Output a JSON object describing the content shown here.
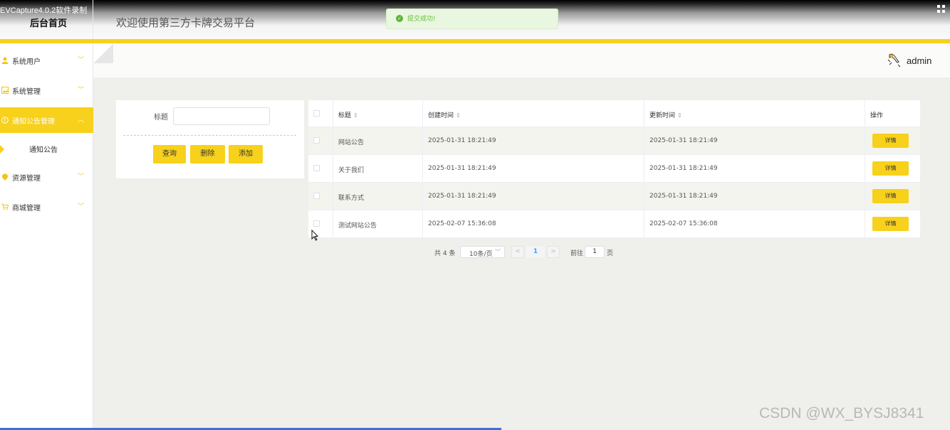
{
  "recorder": {
    "title": "EVCapture4.0.2软件录制"
  },
  "header": {
    "brand": "后台首页",
    "welcome": "欢迎使用第三方卡牌交易平台",
    "toast": "提交成功!",
    "user": "admin"
  },
  "colors": {
    "accent": "#f7d11b",
    "success": "#67c23a",
    "link": "#409eff"
  },
  "sidebar": {
    "items": [
      {
        "label": "系统用户",
        "icon": "user-icon"
      },
      {
        "label": "系统管理",
        "icon": "image-icon"
      },
      {
        "label": "通知公告管理",
        "icon": "info-icon",
        "active": true
      },
      {
        "label": "资源管理",
        "icon": "pin-icon"
      },
      {
        "label": "商城管理",
        "icon": "cart-icon"
      }
    ],
    "sub_item": "通知公告"
  },
  "search": {
    "title_label": "标题",
    "title_value": "",
    "query_label": "查询",
    "delete_label": "删除",
    "add_label": "添加"
  },
  "table": {
    "columns": [
      "标题",
      "创建时间",
      "更新时间",
      "操作"
    ],
    "rows": [
      {
        "title": "网站公告",
        "created": "2025-01-31 18:21:49",
        "updated": "2025-01-31 18:21:49",
        "action": "详情"
      },
      {
        "title": "关于我们",
        "created": "2025-01-31 18:21:49",
        "updated": "2025-01-31 18:21:49",
        "action": "详情"
      },
      {
        "title": "联系方式",
        "created": "2025-01-31 18:21:49",
        "updated": "2025-01-31 18:21:49",
        "action": "详情"
      },
      {
        "title": "测试网站公告",
        "created": "2025-02-07 15:36:08",
        "updated": "2025-02-07 15:36:08",
        "action": "详情"
      }
    ]
  },
  "pagination": {
    "total": "共 4 条",
    "page_size": "10条/页",
    "prev": "<",
    "current": "1",
    "next": ">",
    "goto_label": "前往",
    "goto_value": "1",
    "unit": "页"
  },
  "watermark": "CSDN @WX_BYSJ8341"
}
